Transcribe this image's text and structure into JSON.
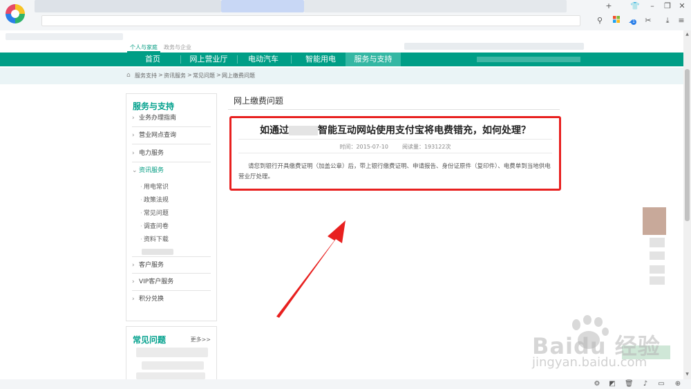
{
  "browser": {
    "toolbar_icons": [
      "shirt-icon",
      "minimize-icon",
      "restore-icon",
      "close-icon",
      "search-icon",
      "apps-icon",
      "notification-icon",
      "cut-icon",
      "download-icon",
      "menu-icon"
    ],
    "plus": "+",
    "minimize": "–",
    "restore": "❐",
    "close": "✕",
    "search_glyph": "⚲",
    "cut_glyph": "✂",
    "download_glyph": "⤓",
    "menu_glyph": "≡",
    "notif_count": "1"
  },
  "site": {
    "top_tabs": {
      "active": "个人与家庭",
      "other": "政务与企业"
    },
    "nav": [
      {
        "label": "首页"
      },
      {
        "label": "网上营业厅"
      },
      {
        "label": "电动汽车"
      },
      {
        "label": "智能用电"
      },
      {
        "label": "服务与支持",
        "active": true
      }
    ],
    "breadcrumb": [
      "服务支持",
      ">",
      "资讯服务",
      ">",
      "常见问题",
      ">",
      "网上缴费问题"
    ]
  },
  "sidebar": {
    "title": "服务与支持",
    "items": [
      {
        "label": "业务办理指南"
      },
      {
        "label": "营业网点查询"
      },
      {
        "label": "电力服务"
      },
      {
        "label": "资讯服务",
        "open": true
      }
    ],
    "sub_items": [
      "用电常识",
      "政策法规",
      "常见问题",
      "调查问卷",
      "资料下载"
    ],
    "items_after": [
      {
        "label": "客户服务"
      },
      {
        "label": "VIP客户服务"
      },
      {
        "label": "积分兑换"
      }
    ],
    "arrow": "›",
    "open_arrow": "⌄"
  },
  "faq": {
    "title": "常见问题",
    "more": "更多>>"
  },
  "main": {
    "section_title": "网上缴费问题",
    "article": {
      "title_before": "如通过",
      "title_after": "智能互动网站使用支付宝将电费错充，如何处理？",
      "time": "时间：2015-07-10",
      "views": "阅读量：193122次",
      "body": "请您到银行开具缴费证明（加盖公章）后，带上银行缴费证明、申请报告、身份证原件（复印件）、电费单到当地供电营业厅处理。"
    }
  },
  "watermark": {
    "text": "Baidu 经验",
    "url": "jingyan.baidu.com"
  },
  "colors": {
    "brand": "#009e86",
    "highlight": "#e8201f"
  }
}
